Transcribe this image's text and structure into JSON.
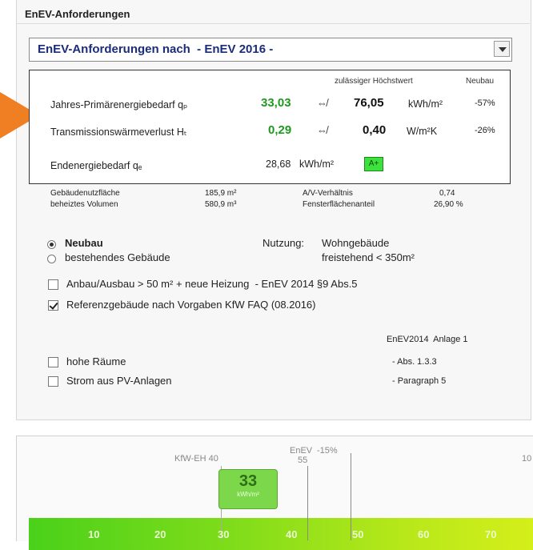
{
  "panel": {
    "title": "EnEV-Anforderungen"
  },
  "dropdown": {
    "value": "EnEV-Anforderungen nach  - EnEV 2016 -"
  },
  "table": {
    "header_max": "zulässiger Höchstwert",
    "header_new": "Neubau",
    "rows": [
      {
        "label": "Jahres-Primärenergiebedarf qₚ",
        "value": "33,03",
        "arrow": "⇎",
        "max": "76,05",
        "unit": "kWh/m²",
        "pct": "-57%"
      },
      {
        "label": "Transmissionswärmeverlust Hₜ",
        "value": "0,29",
        "arrow": "⇎",
        "max": "0,40",
        "unit": "W/m²K",
        "pct": "-26%"
      }
    ],
    "end": {
      "label": "Endenergiebedarf qₑ",
      "value": "28,68",
      "unit": "kWh/m²",
      "badge": "A+"
    }
  },
  "stats": {
    "nutzflaeche_label": "Gebäudenutzfläche",
    "nutzflaeche_value": "185,9 m²",
    "volumen_label": "beheiztes Volumen",
    "volumen_value": "580,9 m³",
    "av_label": "A/V-Verhältnis",
    "av_value": "0,74",
    "fenster_label": "Fensterflächenanteil",
    "fenster_value": "26,90 %"
  },
  "building": {
    "neubau": "Neubau",
    "bestehend": "bestehendes Gebäude",
    "nutzung_label": "Nutzung:",
    "nutzung_line1": "Wohngebäude",
    "nutzung_line2": "freistehend < 350m²"
  },
  "options": {
    "anbau": "Anbau/Ausbau > 50 m² + neue Heizung  - EnEV 2014 §9 Abs.5",
    "referenz": "Referenzgebäude nach Vorgaben KfW FAQ (08.2016)",
    "anlage_header": "EnEV2014  Anlage 1",
    "hohe_raeume": "hohe Räume",
    "hohe_ref": "- Abs. 1.3.3",
    "strom": "Strom aus PV-Anlagen",
    "strom_ref": "- Paragraph 5"
  },
  "scale": {
    "kfw_label": "KfW-EH 40",
    "enev_label": "EnEV",
    "enev_value": "55",
    "minus15": "-15%",
    "right_cut": "10",
    "marker_value": "33",
    "marker_unit": "kWh/m²",
    "ticks": [
      "10",
      "20",
      "30",
      "40",
      "50",
      "60",
      "70"
    ]
  },
  "colors": {
    "title_blue": "#1b2d7a",
    "ok_green": "#1e9a1e",
    "arrow_orange": "#f07e22"
  }
}
